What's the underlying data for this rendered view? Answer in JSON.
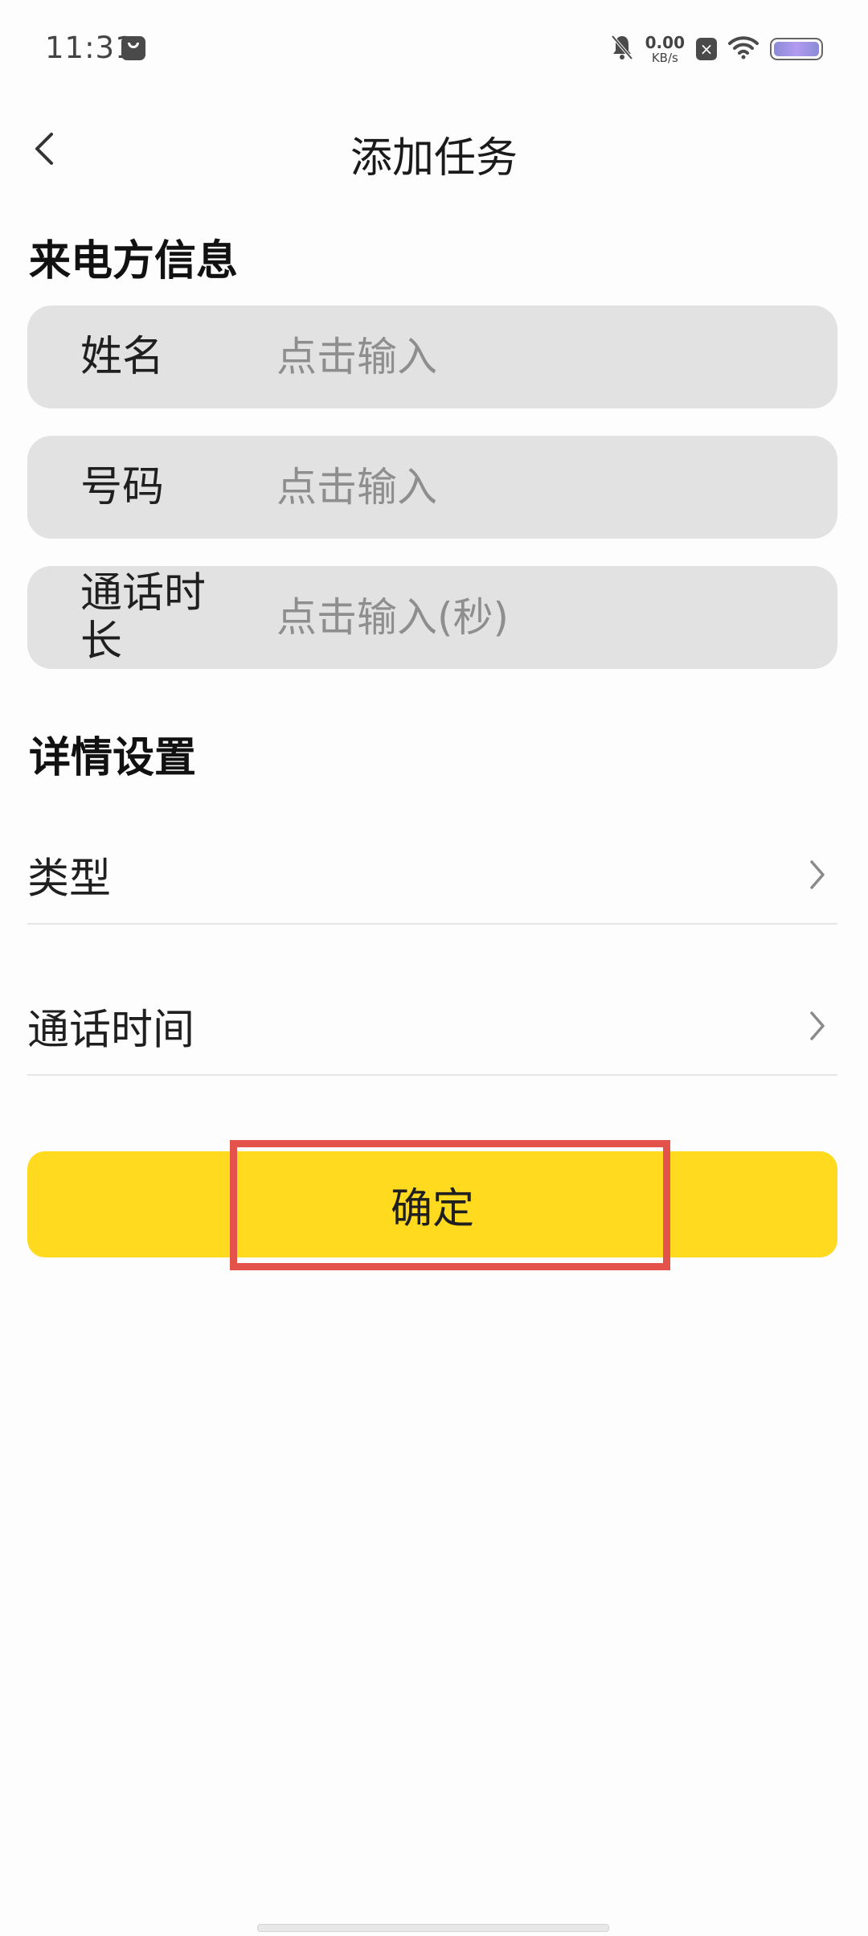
{
  "status_bar": {
    "time": "11:31",
    "net_speed_value": "0.00",
    "net_speed_unit": "KB/s",
    "icons": [
      "message-icon",
      "mute-bell-icon",
      "sim-x-icon",
      "wifi-icon",
      "battery-icon"
    ]
  },
  "nav": {
    "title": "添加任务",
    "back_icon": "chevron-left-icon"
  },
  "caller_section": {
    "title": "来电方信息",
    "fields": [
      {
        "label": "姓名",
        "placeholder": "点击输入",
        "value": ""
      },
      {
        "label": "号码",
        "placeholder": "点击输入",
        "value": ""
      },
      {
        "label": "通话时长",
        "placeholder": "点击输入(秒)",
        "value": ""
      }
    ]
  },
  "detail_section": {
    "title": "详情设置",
    "rows": [
      {
        "label": "类型",
        "icon": "chevron-right-icon"
      },
      {
        "label": "通话时间",
        "icon": "chevron-right-icon"
      }
    ]
  },
  "confirm": {
    "label": "确定"
  },
  "colors": {
    "accent": "#ffda1f",
    "field_bg": "#e2e2e2",
    "highlight": "#e4534b"
  }
}
